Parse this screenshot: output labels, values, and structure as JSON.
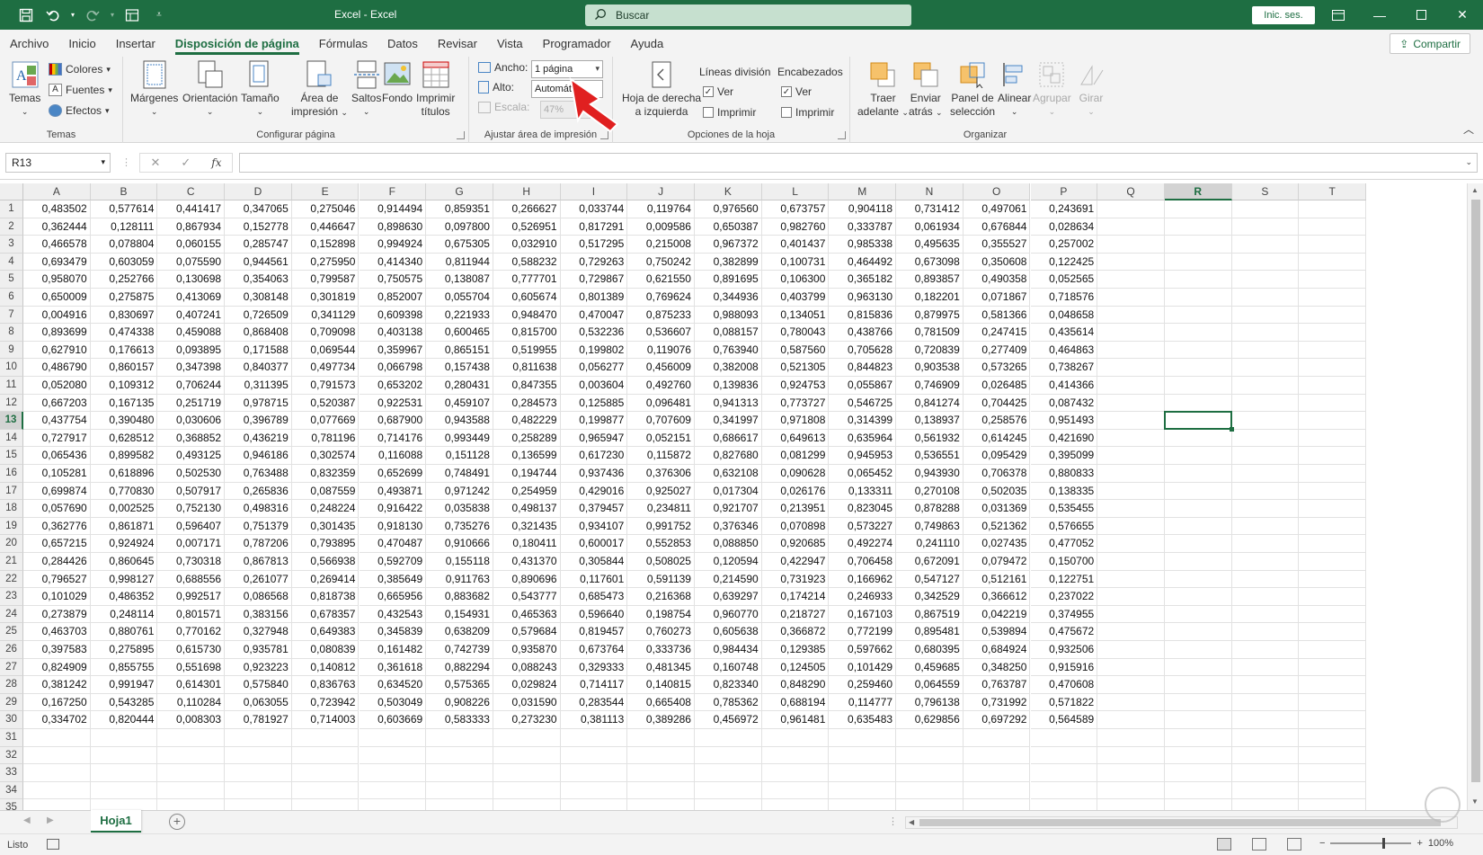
{
  "title": "Excel - Excel",
  "search": {
    "label": "Buscar"
  },
  "signin": "Inic. ses.",
  "tabs": [
    "Archivo",
    "Inicio",
    "Insertar",
    "Disposición de página",
    "Fórmulas",
    "Datos",
    "Revisar",
    "Vista",
    "Programador",
    "Ayuda"
  ],
  "active_tab": "Disposición de página",
  "share": "Compartir",
  "ribbon": {
    "temas": {
      "label": "Temas",
      "temas_btn": "Temas",
      "colores": "Colores",
      "fuentes": "Fuentes",
      "efectos": "Efectos"
    },
    "configurar": {
      "label": "Configurar página",
      "margenes": "Márgenes",
      "orientacion": "Orientación",
      "tamano": "Tamaño",
      "area1": "Área de",
      "area2": "impresión",
      "saltos": "Saltos",
      "fondo": "Fondo",
      "imprimir1": "Imprimir",
      "imprimir2": "títulos"
    },
    "ajustar": {
      "label": "Ajustar área de impresión",
      "ancho": "Ancho:",
      "ancho_val": "1 página",
      "alto": "Alto:",
      "alto_val": "Automát.",
      "escala": "Escala:",
      "escala_val": "47%"
    },
    "opciones": {
      "label": "Opciones de la hoja",
      "hoja1": "Hoja de derecha",
      "hoja2": "a izquierda",
      "lineas": "Líneas división",
      "encabezados": "Encabezados",
      "ver": "Ver",
      "imprimir": "Imprimir"
    },
    "organizar": {
      "label": "Organizar",
      "traer1": "Traer",
      "traer2": "adelante",
      "enviar1": "Enviar",
      "enviar2": "atrás",
      "panel1": "Panel de",
      "panel2": "selección",
      "alinear": "Alinear",
      "agrupar": "Agrupar",
      "girar": "Girar"
    }
  },
  "namebox": "R13",
  "fx": "fx",
  "columns": [
    "A",
    "B",
    "C",
    "D",
    "E",
    "F",
    "G",
    "H",
    "I",
    "J",
    "K",
    "L",
    "M",
    "N",
    "O",
    "P",
    "Q",
    "R",
    "S",
    "T"
  ],
  "selected_column": "R",
  "selected_row": 13,
  "rows": [
    [
      "0,483502",
      "0,577614",
      "0,441417",
      "0,347065",
      "0,275046",
      "0,914494",
      "0,859351",
      "0,266627",
      "0,033744",
      "0,119764",
      "0,976560",
      "0,673757",
      "0,904118",
      "0,731412",
      "0,497061",
      "0,243691"
    ],
    [
      "0,362444",
      "0,128111",
      "0,867934",
      "0,152778",
      "0,446647",
      "0,898630",
      "0,097800",
      "0,526951",
      "0,817291",
      "0,009586",
      "0,650387",
      "0,982760",
      "0,333787",
      "0,061934",
      "0,676844",
      "0,028634"
    ],
    [
      "0,466578",
      "0,078804",
      "0,060155",
      "0,285747",
      "0,152898",
      "0,994924",
      "0,675305",
      "0,032910",
      "0,517295",
      "0,215008",
      "0,967372",
      "0,401437",
      "0,985338",
      "0,495635",
      "0,355527",
      "0,257002"
    ],
    [
      "0,693479",
      "0,603059",
      "0,075590",
      "0,944561",
      "0,275950",
      "0,414340",
      "0,811944",
      "0,588232",
      "0,729263",
      "0,750242",
      "0,382899",
      "0,100731",
      "0,464492",
      "0,673098",
      "0,350608",
      "0,122425"
    ],
    [
      "0,958070",
      "0,252766",
      "0,130698",
      "0,354063",
      "0,799587",
      "0,750575",
      "0,138087",
      "0,777701",
      "0,729867",
      "0,621550",
      "0,891695",
      "0,106300",
      "0,365182",
      "0,893857",
      "0,490358",
      "0,052565"
    ],
    [
      "0,650009",
      "0,275875",
      "0,413069",
      "0,308148",
      "0,301819",
      "0,852007",
      "0,055704",
      "0,605674",
      "0,801389",
      "0,769624",
      "0,344936",
      "0,403799",
      "0,963130",
      "0,182201",
      "0,071867",
      "0,718576"
    ],
    [
      "0,004916",
      "0,830697",
      "0,407241",
      "0,726509",
      "0,341129",
      "0,609398",
      "0,221933",
      "0,948470",
      "0,470047",
      "0,875233",
      "0,988093",
      "0,134051",
      "0,815836",
      "0,879975",
      "0,581366",
      "0,048658"
    ],
    [
      "0,893699",
      "0,474338",
      "0,459088",
      "0,868408",
      "0,709098",
      "0,403138",
      "0,600465",
      "0,815700",
      "0,532236",
      "0,536607",
      "0,088157",
      "0,780043",
      "0,438766",
      "0,781509",
      "0,247415",
      "0,435614"
    ],
    [
      "0,627910",
      "0,176613",
      "0,093895",
      "0,171588",
      "0,069544",
      "0,359967",
      "0,865151",
      "0,519955",
      "0,199802",
      "0,119076",
      "0,763940",
      "0,587560",
      "0,705628",
      "0,720839",
      "0,277409",
      "0,464863"
    ],
    [
      "0,486790",
      "0,860157",
      "0,347398",
      "0,840377",
      "0,497734",
      "0,066798",
      "0,157438",
      "0,811638",
      "0,056277",
      "0,456009",
      "0,382008",
      "0,521305",
      "0,844823",
      "0,903538",
      "0,573265",
      "0,738267"
    ],
    [
      "0,052080",
      "0,109312",
      "0,706244",
      "0,311395",
      "0,791573",
      "0,653202",
      "0,280431",
      "0,847355",
      "0,003604",
      "0,492760",
      "0,139836",
      "0,924753",
      "0,055867",
      "0,746909",
      "0,026485",
      "0,414366"
    ],
    [
      "0,667203",
      "0,167135",
      "0,251719",
      "0,978715",
      "0,520387",
      "0,922531",
      "0,459107",
      "0,284573",
      "0,125885",
      "0,096481",
      "0,941313",
      "0,773727",
      "0,546725",
      "0,841274",
      "0,704425",
      "0,087432"
    ],
    [
      "0,437754",
      "0,390480",
      "0,030606",
      "0,396789",
      "0,077669",
      "0,687900",
      "0,943588",
      "0,482229",
      "0,199877",
      "0,707609",
      "0,341997",
      "0,971808",
      "0,314399",
      "0,138937",
      "0,258576",
      "0,951493"
    ],
    [
      "0,727917",
      "0,628512",
      "0,368852",
      "0,436219",
      "0,781196",
      "0,714176",
      "0,993449",
      "0,258289",
      "0,965947",
      "0,052151",
      "0,686617",
      "0,649613",
      "0,635964",
      "0,561932",
      "0,614245",
      "0,421690"
    ],
    [
      "0,065436",
      "0,899582",
      "0,493125",
      "0,946186",
      "0,302574",
      "0,116088",
      "0,151128",
      "0,136599",
      "0,617230",
      "0,115872",
      "0,827680",
      "0,081299",
      "0,945953",
      "0,536551",
      "0,095429",
      "0,395099"
    ],
    [
      "0,105281",
      "0,618896",
      "0,502530",
      "0,763488",
      "0,832359",
      "0,652699",
      "0,748491",
      "0,194744",
      "0,937436",
      "0,376306",
      "0,632108",
      "0,090628",
      "0,065452",
      "0,943930",
      "0,706378",
      "0,880833"
    ],
    [
      "0,699874",
      "0,770830",
      "0,507917",
      "0,265836",
      "0,087559",
      "0,493871",
      "0,971242",
      "0,254959",
      "0,429016",
      "0,925027",
      "0,017304",
      "0,026176",
      "0,133311",
      "0,270108",
      "0,502035",
      "0,138335"
    ],
    [
      "0,057690",
      "0,002525",
      "0,752130",
      "0,498316",
      "0,248224",
      "0,916422",
      "0,035838",
      "0,498137",
      "0,379457",
      "0,234811",
      "0,921707",
      "0,213951",
      "0,823045",
      "0,878288",
      "0,031369",
      "0,535455"
    ],
    [
      "0,362776",
      "0,861871",
      "0,596407",
      "0,751379",
      "0,301435",
      "0,918130",
      "0,735276",
      "0,321435",
      "0,934107",
      "0,991752",
      "0,376346",
      "0,070898",
      "0,573227",
      "0,749863",
      "0,521362",
      "0,576655"
    ],
    [
      "0,657215",
      "0,924924",
      "0,007171",
      "0,787206",
      "0,793895",
      "0,470487",
      "0,910666",
      "0,180411",
      "0,600017",
      "0,552853",
      "0,088850",
      "0,920685",
      "0,492274",
      "0,241110",
      "0,027435",
      "0,477052"
    ],
    [
      "0,284426",
      "0,860645",
      "0,730318",
      "0,867813",
      "0,566938",
      "0,592709",
      "0,155118",
      "0,431370",
      "0,305844",
      "0,508025",
      "0,120594",
      "0,422947",
      "0,706458",
      "0,672091",
      "0,079472",
      "0,150700"
    ],
    [
      "0,796527",
      "0,998127",
      "0,688556",
      "0,261077",
      "0,269414",
      "0,385649",
      "0,911763",
      "0,890696",
      "0,117601",
      "0,591139",
      "0,214590",
      "0,731923",
      "0,166962",
      "0,547127",
      "0,512161",
      "0,122751"
    ],
    [
      "0,101029",
      "0,486352",
      "0,992517",
      "0,086568",
      "0,818738",
      "0,665956",
      "0,883682",
      "0,543777",
      "0,685473",
      "0,216368",
      "0,639297",
      "0,174214",
      "0,246933",
      "0,342529",
      "0,366612",
      "0,237022"
    ],
    [
      "0,273879",
      "0,248114",
      "0,801571",
      "0,383156",
      "0,678357",
      "0,432543",
      "0,154931",
      "0,465363",
      "0,596640",
      "0,198754",
      "0,960770",
      "0,218727",
      "0,167103",
      "0,867519",
      "0,042219",
      "0,374955"
    ],
    [
      "0,463703",
      "0,880761",
      "0,770162",
      "0,327948",
      "0,649383",
      "0,345839",
      "0,638209",
      "0,579684",
      "0,819457",
      "0,760273",
      "0,605638",
      "0,366872",
      "0,772199",
      "0,895481",
      "0,539894",
      "0,475672"
    ],
    [
      "0,397583",
      "0,275895",
      "0,615730",
      "0,935781",
      "0,080839",
      "0,161482",
      "0,742739",
      "0,935870",
      "0,673764",
      "0,333736",
      "0,984434",
      "0,129385",
      "0,597662",
      "0,680395",
      "0,684924",
      "0,932506"
    ],
    [
      "0,824909",
      "0,855755",
      "0,551698",
      "0,923223",
      "0,140812",
      "0,361618",
      "0,882294",
      "0,088243",
      "0,329333",
      "0,481345",
      "0,160748",
      "0,124505",
      "0,101429",
      "0,459685",
      "0,348250",
      "0,915916"
    ],
    [
      "0,381242",
      "0,991947",
      "0,614301",
      "0,575840",
      "0,836763",
      "0,634520",
      "0,575365",
      "0,029824",
      "0,714117",
      "0,140815",
      "0,823340",
      "0,848290",
      "0,259460",
      "0,064559",
      "0,763787",
      "0,470608"
    ],
    [
      "0,167250",
      "0,543285",
      "0,110284",
      "0,063055",
      "0,723942",
      "0,503049",
      "0,908226",
      "0,031590",
      "0,283544",
      "0,665408",
      "0,785362",
      "0,688194",
      "0,114777",
      "0,796138",
      "0,731992",
      "0,571822"
    ],
    [
      "0,334702",
      "0,820444",
      "0,008303",
      "0,781927",
      "0,714003",
      "0,603669",
      "0,583333",
      "0,273230",
      "0,381113",
      "0,389286",
      "0,456972",
      "0,961481",
      "0,635483",
      "0,629856",
      "0,697292",
      "0,564589"
    ]
  ],
  "total_rows": 35,
  "sheet": "Hoja1",
  "status": "Listo",
  "zoom": "100%",
  "colors": {
    "accent": "#1e6e42",
    "title_bg": "#1e6e42",
    "arrow": "#e02020"
  }
}
